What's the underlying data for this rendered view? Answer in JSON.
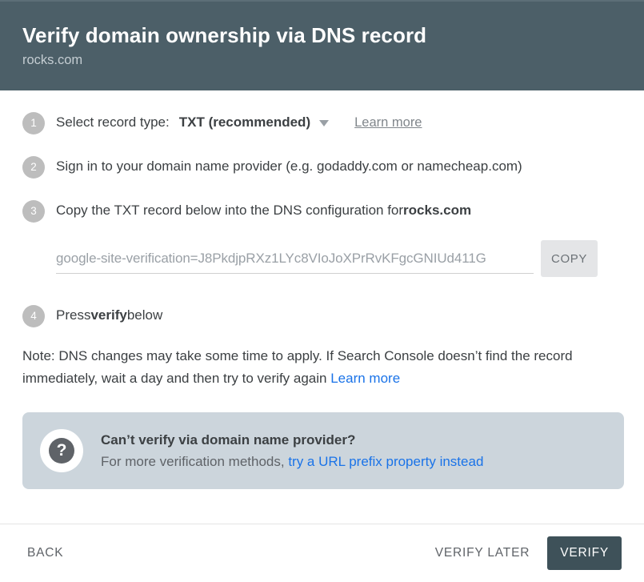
{
  "header": {
    "title": "Verify domain ownership via DNS record",
    "subtitle": "rocks.com"
  },
  "steps": {
    "one": {
      "number": "1",
      "label": "Select record type:",
      "selected_value": "TXT (recommended)",
      "chevron_icon": "chevron-down-icon",
      "learn_more": "Learn more"
    },
    "two": {
      "number": "2",
      "text": "Sign in to your domain name provider (e.g. godaddy.com or namecheap.com)"
    },
    "three": {
      "number": "3",
      "text_before": "Copy the TXT record below into the DNS configuration for ",
      "domain": "rocks.com"
    },
    "four": {
      "number": "4",
      "text_before": "Press ",
      "emphasis": "verify",
      "text_after": " below"
    }
  },
  "record": {
    "value": "google-site-verification=J8PkdjpRXz1LYc8VIoJoXPrRvKFgcGNIUd411G",
    "copy_label": "COPY"
  },
  "note": {
    "text": "Note: DNS changes may take some time to apply. If Search Console doesn’t find the record immediately, wait a day and then try to verify again ",
    "link": "Learn more"
  },
  "callout": {
    "icon": "question-mark-icon",
    "icon_glyph": "?",
    "title": "Can’t verify via domain name provider?",
    "text_before": "For more verification methods, ",
    "link": "try a URL prefix property instead"
  },
  "footer": {
    "back": "BACK",
    "verify_later": "VERIFY LATER",
    "verify": "VERIFY"
  },
  "colors": {
    "header_bg": "#4c5f68",
    "primary_button": "#3e5159",
    "callout_bg": "#ccd5dc",
    "link_blue": "#1a73e8",
    "badge_gray": "#bdbdbd"
  }
}
